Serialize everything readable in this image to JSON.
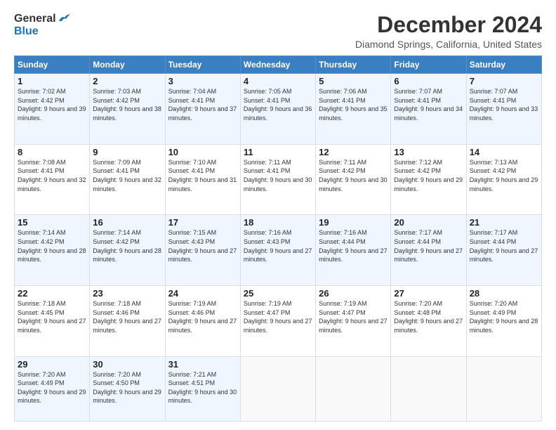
{
  "header": {
    "logo_line1": "General",
    "logo_line2": "Blue",
    "main_title": "December 2024",
    "subtitle": "Diamond Springs, California, United States"
  },
  "calendar": {
    "days_of_week": [
      "Sunday",
      "Monday",
      "Tuesday",
      "Wednesday",
      "Thursday",
      "Friday",
      "Saturday"
    ],
    "weeks": [
      [
        {
          "day": "1",
          "sunrise": "7:02 AM",
          "sunset": "4:42 PM",
          "daylight": "9 hours and 39 minutes."
        },
        {
          "day": "2",
          "sunrise": "7:03 AM",
          "sunset": "4:42 PM",
          "daylight": "9 hours and 38 minutes."
        },
        {
          "day": "3",
          "sunrise": "7:04 AM",
          "sunset": "4:41 PM",
          "daylight": "9 hours and 37 minutes."
        },
        {
          "day": "4",
          "sunrise": "7:05 AM",
          "sunset": "4:41 PM",
          "daylight": "9 hours and 36 minutes."
        },
        {
          "day": "5",
          "sunrise": "7:06 AM",
          "sunset": "4:41 PM",
          "daylight": "9 hours and 35 minutes."
        },
        {
          "day": "6",
          "sunrise": "7:07 AM",
          "sunset": "4:41 PM",
          "daylight": "9 hours and 34 minutes."
        },
        {
          "day": "7",
          "sunrise": "7:07 AM",
          "sunset": "4:41 PM",
          "daylight": "9 hours and 33 minutes."
        }
      ],
      [
        {
          "day": "8",
          "sunrise": "7:08 AM",
          "sunset": "4:41 PM",
          "daylight": "9 hours and 32 minutes."
        },
        {
          "day": "9",
          "sunrise": "7:09 AM",
          "sunset": "4:41 PM",
          "daylight": "9 hours and 32 minutes."
        },
        {
          "day": "10",
          "sunrise": "7:10 AM",
          "sunset": "4:41 PM",
          "daylight": "9 hours and 31 minutes."
        },
        {
          "day": "11",
          "sunrise": "7:11 AM",
          "sunset": "4:41 PM",
          "daylight": "9 hours and 30 minutes."
        },
        {
          "day": "12",
          "sunrise": "7:11 AM",
          "sunset": "4:42 PM",
          "daylight": "9 hours and 30 minutes."
        },
        {
          "day": "13",
          "sunrise": "7:12 AM",
          "sunset": "4:42 PM",
          "daylight": "9 hours and 29 minutes."
        },
        {
          "day": "14",
          "sunrise": "7:13 AM",
          "sunset": "4:42 PM",
          "daylight": "9 hours and 29 minutes."
        }
      ],
      [
        {
          "day": "15",
          "sunrise": "7:14 AM",
          "sunset": "4:42 PM",
          "daylight": "9 hours and 28 minutes."
        },
        {
          "day": "16",
          "sunrise": "7:14 AM",
          "sunset": "4:42 PM",
          "daylight": "9 hours and 28 minutes."
        },
        {
          "day": "17",
          "sunrise": "7:15 AM",
          "sunset": "4:43 PM",
          "daylight": "9 hours and 27 minutes."
        },
        {
          "day": "18",
          "sunrise": "7:16 AM",
          "sunset": "4:43 PM",
          "daylight": "9 hours and 27 minutes."
        },
        {
          "day": "19",
          "sunrise": "7:16 AM",
          "sunset": "4:44 PM",
          "daylight": "9 hours and 27 minutes."
        },
        {
          "day": "20",
          "sunrise": "7:17 AM",
          "sunset": "4:44 PM",
          "daylight": "9 hours and 27 minutes."
        },
        {
          "day": "21",
          "sunrise": "7:17 AM",
          "sunset": "4:44 PM",
          "daylight": "9 hours and 27 minutes."
        }
      ],
      [
        {
          "day": "22",
          "sunrise": "7:18 AM",
          "sunset": "4:45 PM",
          "daylight": "9 hours and 27 minutes."
        },
        {
          "day": "23",
          "sunrise": "7:18 AM",
          "sunset": "4:46 PM",
          "daylight": "9 hours and 27 minutes."
        },
        {
          "day": "24",
          "sunrise": "7:19 AM",
          "sunset": "4:46 PM",
          "daylight": "9 hours and 27 minutes."
        },
        {
          "day": "25",
          "sunrise": "7:19 AM",
          "sunset": "4:47 PM",
          "daylight": "9 hours and 27 minutes."
        },
        {
          "day": "26",
          "sunrise": "7:19 AM",
          "sunset": "4:47 PM",
          "daylight": "9 hours and 27 minutes."
        },
        {
          "day": "27",
          "sunrise": "7:20 AM",
          "sunset": "4:48 PM",
          "daylight": "9 hours and 27 minutes."
        },
        {
          "day": "28",
          "sunrise": "7:20 AM",
          "sunset": "4:49 PM",
          "daylight": "9 hours and 28 minutes."
        }
      ],
      [
        {
          "day": "29",
          "sunrise": "7:20 AM",
          "sunset": "4:49 PM",
          "daylight": "9 hours and 29 minutes."
        },
        {
          "day": "30",
          "sunrise": "7:20 AM",
          "sunset": "4:50 PM",
          "daylight": "9 hours and 29 minutes."
        },
        {
          "day": "31",
          "sunrise": "7:21 AM",
          "sunset": "4:51 PM",
          "daylight": "9 hours and 30 minutes."
        },
        null,
        null,
        null,
        null
      ]
    ]
  }
}
